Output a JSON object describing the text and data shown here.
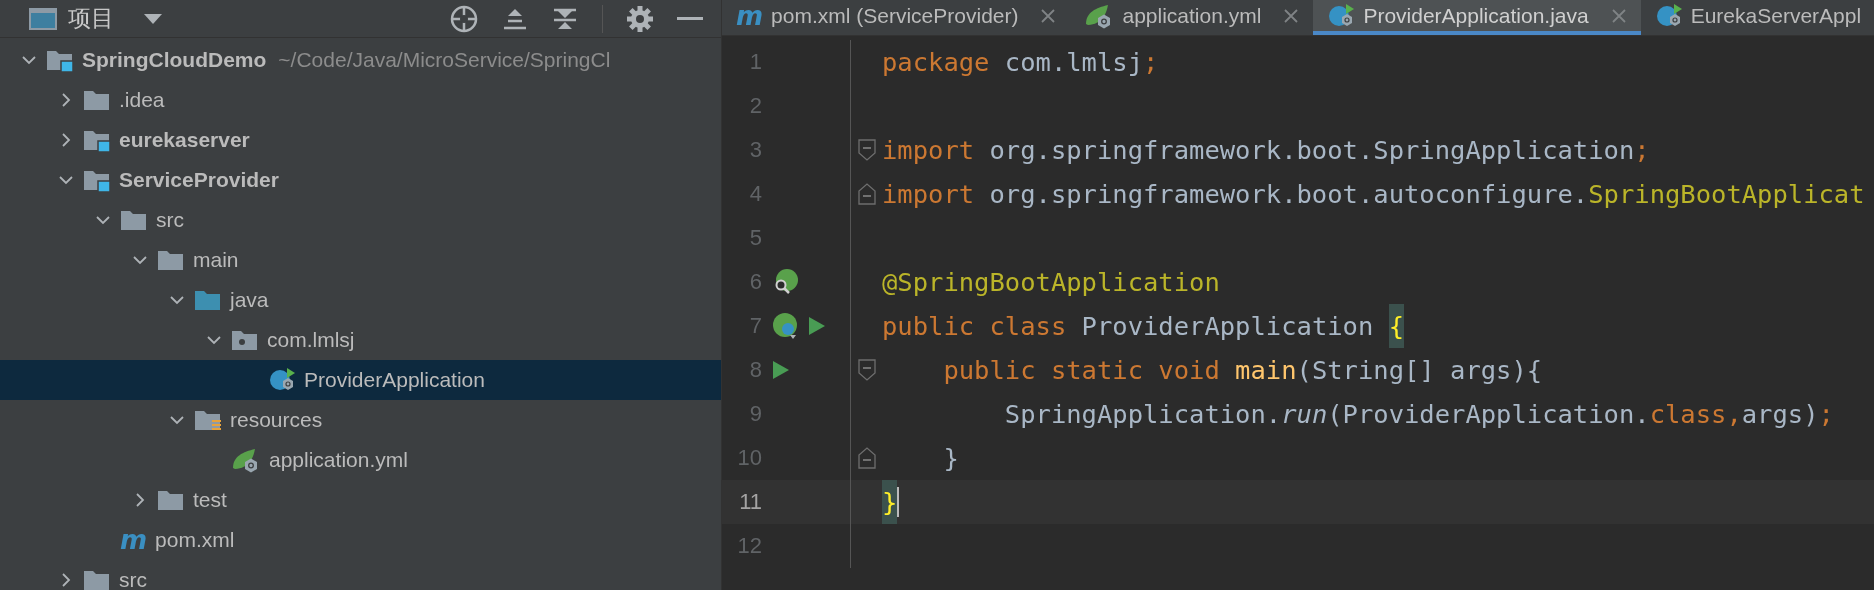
{
  "project_panel": {
    "title": "项目",
    "tree": [
      {
        "name": "SpringCloudDemo",
        "kind": "module",
        "path": "~/Code/Java/MicroService/SpringCl",
        "expanded": true,
        "selected": false,
        "children": [
          {
            "name": ".idea",
            "kind": "folder",
            "expanded": false,
            "selected": false
          },
          {
            "name": "eurekaserver",
            "kind": "module",
            "expanded": false,
            "selected": false
          },
          {
            "name": "ServiceProvider",
            "kind": "module",
            "expanded": true,
            "selected": false,
            "children": [
              {
                "name": "src",
                "kind": "folder",
                "expanded": true,
                "selected": false,
                "children": [
                  {
                    "name": "main",
                    "kind": "folder",
                    "expanded": true,
                    "selected": false,
                    "children": [
                      {
                        "name": "java",
                        "kind": "source",
                        "expanded": true,
                        "selected": false,
                        "children": [
                          {
                            "name": "com.lmlsj",
                            "kind": "package",
                            "expanded": true,
                            "selected": false,
                            "children": [
                              {
                                "name": "ProviderApplication",
                                "kind": "spring-class",
                                "selected": true
                              }
                            ]
                          }
                        ]
                      },
                      {
                        "name": "resources",
                        "kind": "resources",
                        "expanded": true,
                        "selected": false,
                        "children": [
                          {
                            "name": "application.yml",
                            "kind": "yaml",
                            "selected": false
                          }
                        ]
                      }
                    ]
                  },
                  {
                    "name": "test",
                    "kind": "folder",
                    "expanded": false,
                    "selected": false
                  }
                ]
              },
              {
                "name": "pom.xml",
                "kind": "maven",
                "glyph": "m",
                "selected": false
              }
            ]
          },
          {
            "name": "src",
            "kind": "folder",
            "expanded": false,
            "selected": false
          }
        ]
      }
    ]
  },
  "editor": {
    "tabs": [
      {
        "label": "pom.xml (ServiceProvider)",
        "kind": "maven",
        "glyph": "m",
        "selected": false,
        "closable": true
      },
      {
        "label": "application.yml",
        "kind": "yaml",
        "selected": false,
        "closable": true
      },
      {
        "label": "ProviderApplication.java",
        "kind": "spring-class",
        "selected": true,
        "closable": true
      },
      {
        "label": "EurekaServerAppl",
        "kind": "spring-class",
        "selected": false,
        "closable": false
      }
    ],
    "lines": [
      {
        "number": "1",
        "current": false,
        "tokens": [
          {
            "kind": "keyword",
            "text": "package "
          },
          {
            "kind": "plain",
            "text": "com.lmlsj"
          },
          {
            "kind": "keyword",
            "text": ";"
          }
        ]
      },
      {
        "number": "2",
        "current": false
      },
      {
        "number": "3",
        "current": false,
        "gutter": [
          {
            "kind": "fold-start"
          }
        ],
        "tokens": [
          {
            "kind": "keyword",
            "text": "import "
          },
          {
            "kind": "plain",
            "text": "org.springframework.boot.SpringApplication"
          },
          {
            "kind": "keyword",
            "text": ";"
          }
        ]
      },
      {
        "number": "4",
        "current": false,
        "gutter": [
          {
            "kind": "fold-end"
          }
        ],
        "tokens": [
          {
            "kind": "keyword",
            "text": "import "
          },
          {
            "kind": "plain",
            "text": "org.springframework.boot.autoconfigure."
          },
          {
            "kind": "annotation",
            "text": "SpringBootApplicat"
          }
        ]
      },
      {
        "number": "5",
        "current": false
      },
      {
        "number": "6",
        "current": false,
        "gutter": [
          {
            "kind": "bean-search"
          }
        ],
        "tokens": [
          {
            "kind": "annotation",
            "text": "@SpringBootApplication"
          }
        ]
      },
      {
        "number": "7",
        "current": false,
        "gutter": [
          {
            "kind": "bean"
          },
          {
            "kind": "run"
          }
        ],
        "tokens": [
          {
            "kind": "keyword",
            "text": "public class "
          },
          {
            "kind": "plain",
            "text": "ProviderApplication "
          },
          {
            "kind": "brace",
            "text": "{"
          }
        ]
      },
      {
        "number": "8",
        "current": false,
        "gutter": [
          {
            "kind": "run"
          },
          {
            "kind": "fold-start"
          }
        ],
        "tokens": [
          {
            "kind": "keyword",
            "text": "    public static void "
          },
          {
            "kind": "method",
            "text": "main"
          },
          {
            "kind": "plain",
            "text": "(String[] args){"
          }
        ]
      },
      {
        "number": "9",
        "current": false,
        "tokens": [
          {
            "kind": "plain",
            "text": "        SpringApplication."
          },
          {
            "kind": "italic",
            "text": "run"
          },
          {
            "kind": "plain",
            "text": "(ProviderApplication."
          },
          {
            "kind": "keyword",
            "text": "class,"
          },
          {
            "kind": "plain",
            "text": "args)"
          },
          {
            "kind": "keyword",
            "text": ";"
          }
        ]
      },
      {
        "number": "10",
        "current": false,
        "gutter": [
          {
            "kind": "fold-end"
          }
        ],
        "tokens": [
          {
            "kind": "plain",
            "text": "    }"
          }
        ]
      },
      {
        "number": "11",
        "current": true,
        "tokens": [
          {
            "kind": "brace",
            "text": "}"
          }
        ]
      },
      {
        "number": "12",
        "current": false
      }
    ]
  }
}
